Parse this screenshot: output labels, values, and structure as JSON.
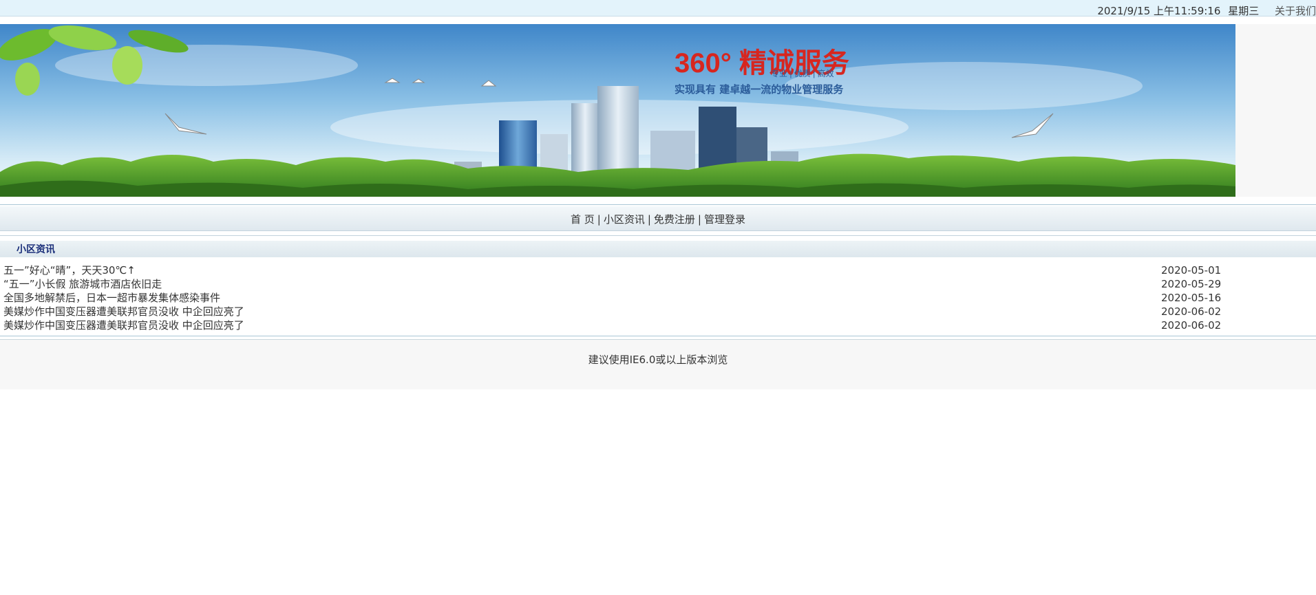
{
  "topbar": {
    "datetime": "2021/9/15 上午11:59:16",
    "weekday": "星期三",
    "about": "关于我们"
  },
  "banner": {
    "headline": "360° 精诚服务",
    "tagline": "专业 | 优质 | 高效",
    "slogan": "实现具有  建卓越一流的物业管理服务"
  },
  "nav": {
    "items": [
      {
        "label": "首 页"
      },
      {
        "label": "小区资讯"
      },
      {
        "label": "免费注册"
      },
      {
        "label": "管理登录"
      }
    ],
    "separator": "|"
  },
  "section": {
    "title": "小区资讯"
  },
  "news": [
    {
      "title": "五一”好心“晴”，天天30℃↑",
      "date": "2020-05-01"
    },
    {
      "title": "“五一”小长假 旅游城市酒店依旧走",
      "date": "2020-05-29"
    },
    {
      "title": "全国多地解禁后，日本一超市暴发集体感染事件",
      "date": "2020-05-16"
    },
    {
      "title": "美媒炒作中国变压器遭美联邦官员没收 中企回应亮了",
      "date": "2020-06-02"
    },
    {
      "title": "美媒炒作中国变压器遭美联邦官员没收 中企回应亮了",
      "date": "2020-06-02"
    }
  ],
  "footer": {
    "text": "建议使用IE6.0或以上版本浏览"
  }
}
